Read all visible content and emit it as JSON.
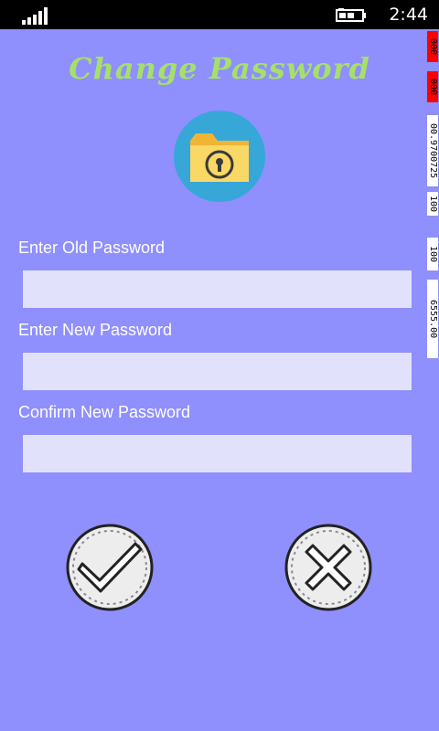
{
  "status_bar": {
    "time": "2:44",
    "signal_icon": "signal-bars-icon",
    "battery_icon": "battery-charging-icon"
  },
  "debug_counters": [
    "000",
    "000",
    "00.9700725",
    "100",
    "100",
    "6555.00"
  ],
  "header": {
    "title": "Change Password",
    "title_color": "#a6e069",
    "logo_icon": "locked-folder-icon"
  },
  "form": {
    "old_password_label": "Enter Old Password",
    "old_password_value": "",
    "new_password_label": "Enter New Password",
    "new_password_value": "",
    "confirm_password_label": "Confirm New Password",
    "confirm_password_value": ""
  },
  "actions": {
    "confirm_icon": "checkmark-icon",
    "cancel_icon": "x-icon"
  },
  "colors": {
    "background": "#8f8ffd",
    "input_background": "#e2e1fb",
    "logo_circle": "#37a7d8",
    "folder": "#f8cf4b"
  }
}
